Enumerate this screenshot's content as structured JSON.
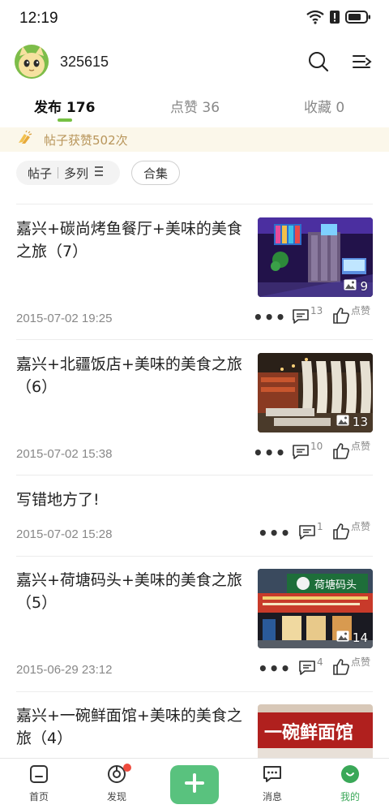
{
  "status_bar": {
    "time": "12:19"
  },
  "profile": {
    "username": "325615"
  },
  "tabs": [
    {
      "label": "发布 176"
    },
    {
      "label": "点赞 36"
    },
    {
      "label": "收藏 0"
    }
  ],
  "banner": {
    "text": "帖子获赞502次"
  },
  "filters": {
    "type_label": "帖子",
    "layout_label": "多列",
    "collect_label": "合集"
  },
  "posts": [
    {
      "title": "嘉兴+碳尚烤鱼餐厅+美味的美食之旅（7）",
      "date": "2015-07-02 19:25",
      "image_count": "9",
      "comments": "13",
      "like_label": "点赞"
    },
    {
      "title": "嘉兴+北疆饭店+美味的美食之旅（6）",
      "date": "2015-07-02 15:38",
      "image_count": "13",
      "comments": "10",
      "like_label": "点赞"
    },
    {
      "title": "写错地方了!",
      "date": "2015-07-02 15:28",
      "image_count": "",
      "comments": "1",
      "like_label": "点赞"
    },
    {
      "title": "嘉兴+荷塘码头+美味的美食之旅（5）",
      "date": "2015-06-29 23:12",
      "image_count": "14",
      "comments": "4",
      "like_label": "点赞"
    },
    {
      "title": "嘉兴+一碗鲜面馆+美味的美食之旅（4）",
      "date": "",
      "image_count": "",
      "comments": "",
      "like_label": ""
    }
  ],
  "thumb_signs": {
    "post4": "荷塘码头",
    "post5": "一碗鲜面馆"
  },
  "bottom_nav": [
    {
      "label": "首页"
    },
    {
      "label": "发现"
    },
    {
      "label": ""
    },
    {
      "label": "消息"
    },
    {
      "label": "我的"
    }
  ],
  "colors": {
    "accent": "#76c043",
    "nav_active": "#3aa858",
    "publish": "#59c27e",
    "banner_text": "#b8955a"
  }
}
